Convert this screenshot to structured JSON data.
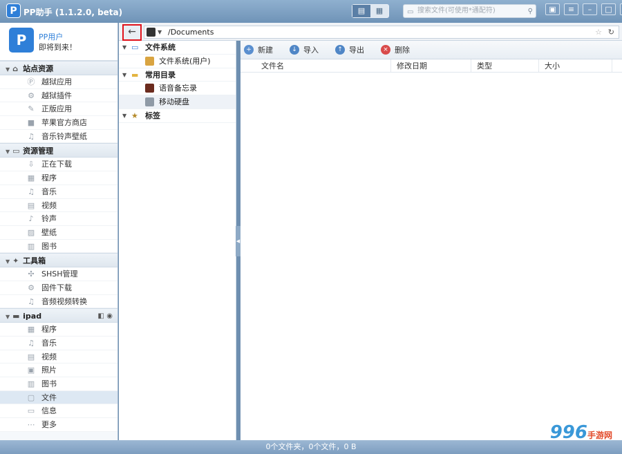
{
  "app": {
    "title": "PP助手 (1.1.2.0, beta)",
    "logo": "P"
  },
  "search": {
    "placeholder": "搜索文件(可使用*通配符)"
  },
  "view": {
    "list_icon": "▤",
    "grid_icon": "▦"
  },
  "user": {
    "name": "PP用户",
    "message": "即将到来！"
  },
  "sections": [
    {
      "label": "站点资源",
      "icon": "home-icon",
      "items": [
        {
          "label": "越狱应用",
          "icon": "app-icon"
        },
        {
          "label": "越狱插件",
          "icon": "plugin-icon"
        },
        {
          "label": "正版应用",
          "icon": "appstore-icon"
        },
        {
          "label": "苹果官方商店",
          "icon": "apple-icon"
        },
        {
          "label": "音乐铃声壁纸",
          "icon": "music-icon"
        }
      ]
    },
    {
      "label": "资源管理",
      "icon": "monitor-icon",
      "items": [
        {
          "label": "正在下载",
          "icon": "download-icon"
        },
        {
          "label": "程序",
          "icon": "grid-icon"
        },
        {
          "label": "音乐",
          "icon": "music-icon"
        },
        {
          "label": "视频",
          "icon": "film-icon"
        },
        {
          "label": "铃声",
          "icon": "note-icon"
        },
        {
          "label": "壁纸",
          "icon": "image-icon"
        },
        {
          "label": "图书",
          "icon": "book-icon"
        }
      ]
    },
    {
      "label": "工具箱",
      "icon": "wrench-icon",
      "items": [
        {
          "label": "SHSH管理",
          "icon": "shsh-icon"
        },
        {
          "label": "固件下载",
          "icon": "firmware-icon"
        },
        {
          "label": "音频视频转换",
          "icon": "convert-icon"
        }
      ]
    },
    {
      "label": "ipad",
      "icon": "ipad-icon",
      "badges": "◧ ◉",
      "items": [
        {
          "label": "程序",
          "icon": "grid-icon"
        },
        {
          "label": "音乐",
          "icon": "music-icon"
        },
        {
          "label": "视频",
          "icon": "film-icon"
        },
        {
          "label": "照片",
          "icon": "photo-icon"
        },
        {
          "label": "图书",
          "icon": "book-icon"
        },
        {
          "label": "文件",
          "icon": "file-icon"
        },
        {
          "label": "信息",
          "icon": "message-icon"
        },
        {
          "label": "更多",
          "icon": "more-icon"
        }
      ]
    }
  ],
  "path": {
    "value": "/Documents"
  },
  "tree": [
    {
      "label": "文件系统",
      "children": [
        {
          "label": "文件系统(用户)"
        }
      ]
    },
    {
      "label": "常用目录",
      "children": [
        {
          "label": "语音备忘录"
        },
        {
          "label": "移动硬盘"
        }
      ]
    },
    {
      "label": "标签",
      "children": []
    }
  ],
  "actions": [
    {
      "label": "新建",
      "color": "#5a8fcf",
      "glyph": "+"
    },
    {
      "label": "导入",
      "color": "#4f86c6",
      "glyph": "↓"
    },
    {
      "label": "导出",
      "color": "#4f86c6",
      "glyph": "↑"
    },
    {
      "label": "删除",
      "color": "#d94b4b",
      "glyph": "×"
    }
  ],
  "columns": [
    "文件名",
    "修改日期",
    "类型",
    "大小"
  ],
  "status": "0个文件夹，0个文件，0 B",
  "watermark": {
    "text": "996",
    "sub": "手游网"
  }
}
